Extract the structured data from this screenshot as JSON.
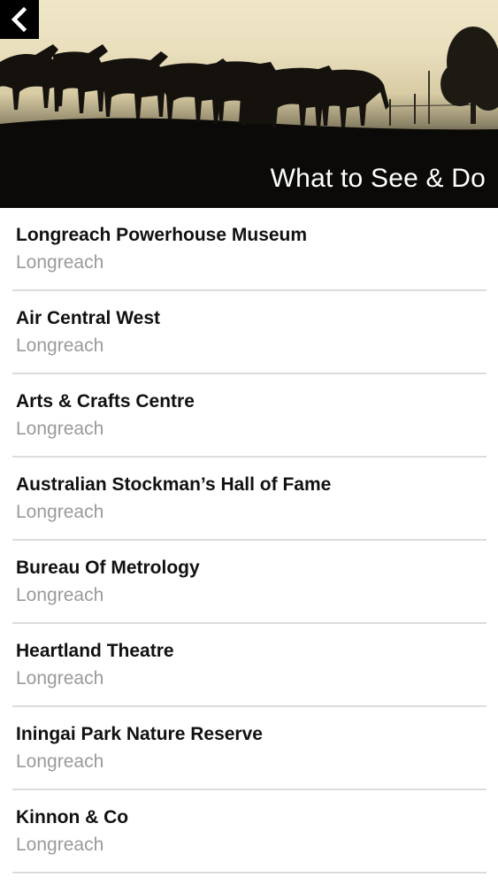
{
  "header": {
    "title": "What to See & Do",
    "back_icon": "chevron-left-icon"
  },
  "colors": {
    "header_background": "#0c0b09",
    "title_text": "#ffffff",
    "item_title": "#111111",
    "item_subtitle": "#9a9a9a",
    "divider": "#dcdcdc"
  },
  "list": {
    "items": [
      {
        "name": "Longreach Powerhouse Museum",
        "location": "Longreach"
      },
      {
        "name": "Air Central West",
        "location": "Longreach"
      },
      {
        "name": "Arts & Crafts Centre",
        "location": "Longreach"
      },
      {
        "name": "Australian Stockman’s Hall of Fame",
        "location": "Longreach"
      },
      {
        "name": "Bureau Of Metrology",
        "location": "Longreach"
      },
      {
        "name": "Heartland Theatre",
        "location": "Longreach"
      },
      {
        "name": "Iningai Park Nature Reserve",
        "location": "Longreach"
      },
      {
        "name": "Kinnon & Co",
        "location": "Longreach"
      }
    ]
  }
}
